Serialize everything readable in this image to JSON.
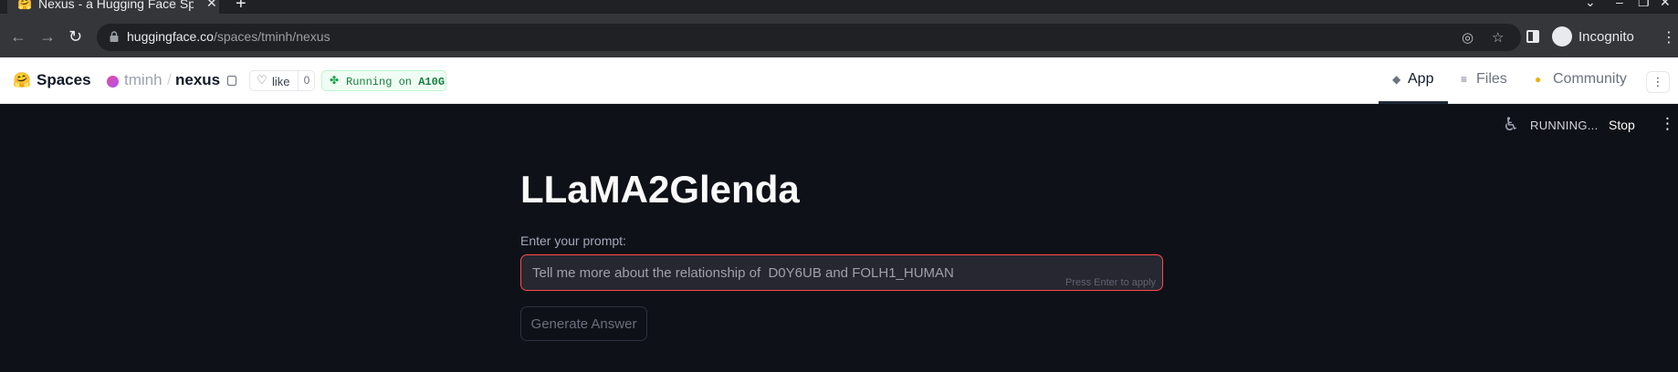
{
  "browser": {
    "tab_title": "Nexus - a Hugging Face Sp",
    "new_tab_glyph": "+",
    "url_domain": "huggingface.co",
    "url_path": "/spaces/tminh/nexus",
    "profile_label": "Incognito"
  },
  "hf_header": {
    "brand": "Spaces",
    "owner": "tminh",
    "separator": "/",
    "repo": "nexus",
    "like_label": "like",
    "like_count": "0",
    "status_prefix": "Running on",
    "status_hardware": "A10G",
    "tabs": [
      {
        "label": "App",
        "icon": "cube-icon",
        "active": true
      },
      {
        "label": "Files",
        "icon": "list-icon",
        "active": false
      },
      {
        "label": "Community",
        "icon": "chat-icon",
        "active": false
      }
    ]
  },
  "app": {
    "status_label": "RUNNING...",
    "stop_label": "Stop",
    "title": "LLaMA2Glenda",
    "prompt_label": "Enter your prompt:",
    "prompt_value": "Tell me more about the relationship of  D0Y6UB and FOLH1_HUMAN",
    "press_enter_hint": "Press Enter to apply",
    "generate_label": "Generate Answer"
  },
  "colors": {
    "app_bg": "#0e1117",
    "accent_red": "#ff4b4b",
    "running_green": "#16a34a"
  }
}
